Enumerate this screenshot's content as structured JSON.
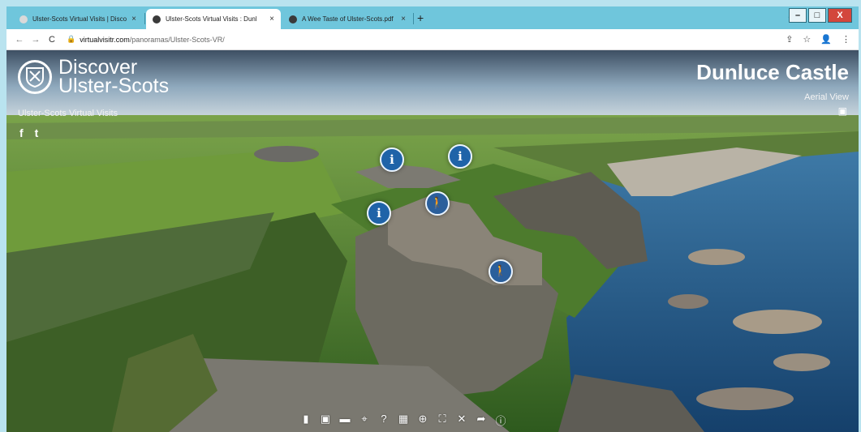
{
  "browser": {
    "tabs": [
      {
        "title": "Ulster-Scots Virtual Visits | Disco",
        "active": false,
        "favicon_color": "#d9d9d9"
      },
      {
        "title": "Ulster-Scots Virtual Visits : Dunl",
        "active": true,
        "favicon_color": "#3a3a3a"
      },
      {
        "title": "A Wee Taste of Ulster-Scots.pdf",
        "active": false,
        "favicon_color": "#3a3a3a"
      }
    ],
    "close_glyph": "×",
    "new_tab_glyph": "+",
    "tab_list_glyph": "⌄",
    "window_controls": {
      "minimize": "–",
      "maximize": "□",
      "close": "X"
    },
    "url": {
      "host": "virtualvisitr.com",
      "path": "/panoramas/Ulster-Scots-VR/"
    },
    "nav_icons": {
      "back": "←",
      "forward": "→",
      "reload": "C",
      "lock": "🔒"
    },
    "toolbar_icons": {
      "share": "⇪",
      "star": "☆",
      "profile": "👤",
      "menu": "⋮"
    }
  },
  "viewer": {
    "brand_line1": "Discover",
    "brand_line2": "Ulster-Scots",
    "tagline": "Ulster-Scots Virtual Visits",
    "social": {
      "facebook": "f",
      "twitter": "t"
    },
    "place_title": "Dunluce Castle",
    "place_subtitle": "Aerial View",
    "corner_glyph": "▣",
    "hotspot_info_glyph": "i",
    "hotspot_walk_glyph": "🚶",
    "controls": [
      {
        "name": "map-icon",
        "glyph": "▮"
      },
      {
        "name": "photo-icon",
        "glyph": "▣"
      },
      {
        "name": "vr-icon",
        "glyph": "▬"
      },
      {
        "name": "location-icon",
        "glyph": "⌖"
      },
      {
        "name": "help-icon",
        "glyph": "?"
      },
      {
        "name": "grid-icon",
        "glyph": "▦"
      },
      {
        "name": "rotate-icon",
        "glyph": "⊕"
      },
      {
        "name": "fullscreen-icon",
        "glyph": "⛶"
      },
      {
        "name": "sound-off-icon",
        "glyph": "✕"
      },
      {
        "name": "share-icon",
        "glyph": "➦"
      },
      {
        "name": "info-icon",
        "glyph": "ⓘ"
      }
    ]
  }
}
